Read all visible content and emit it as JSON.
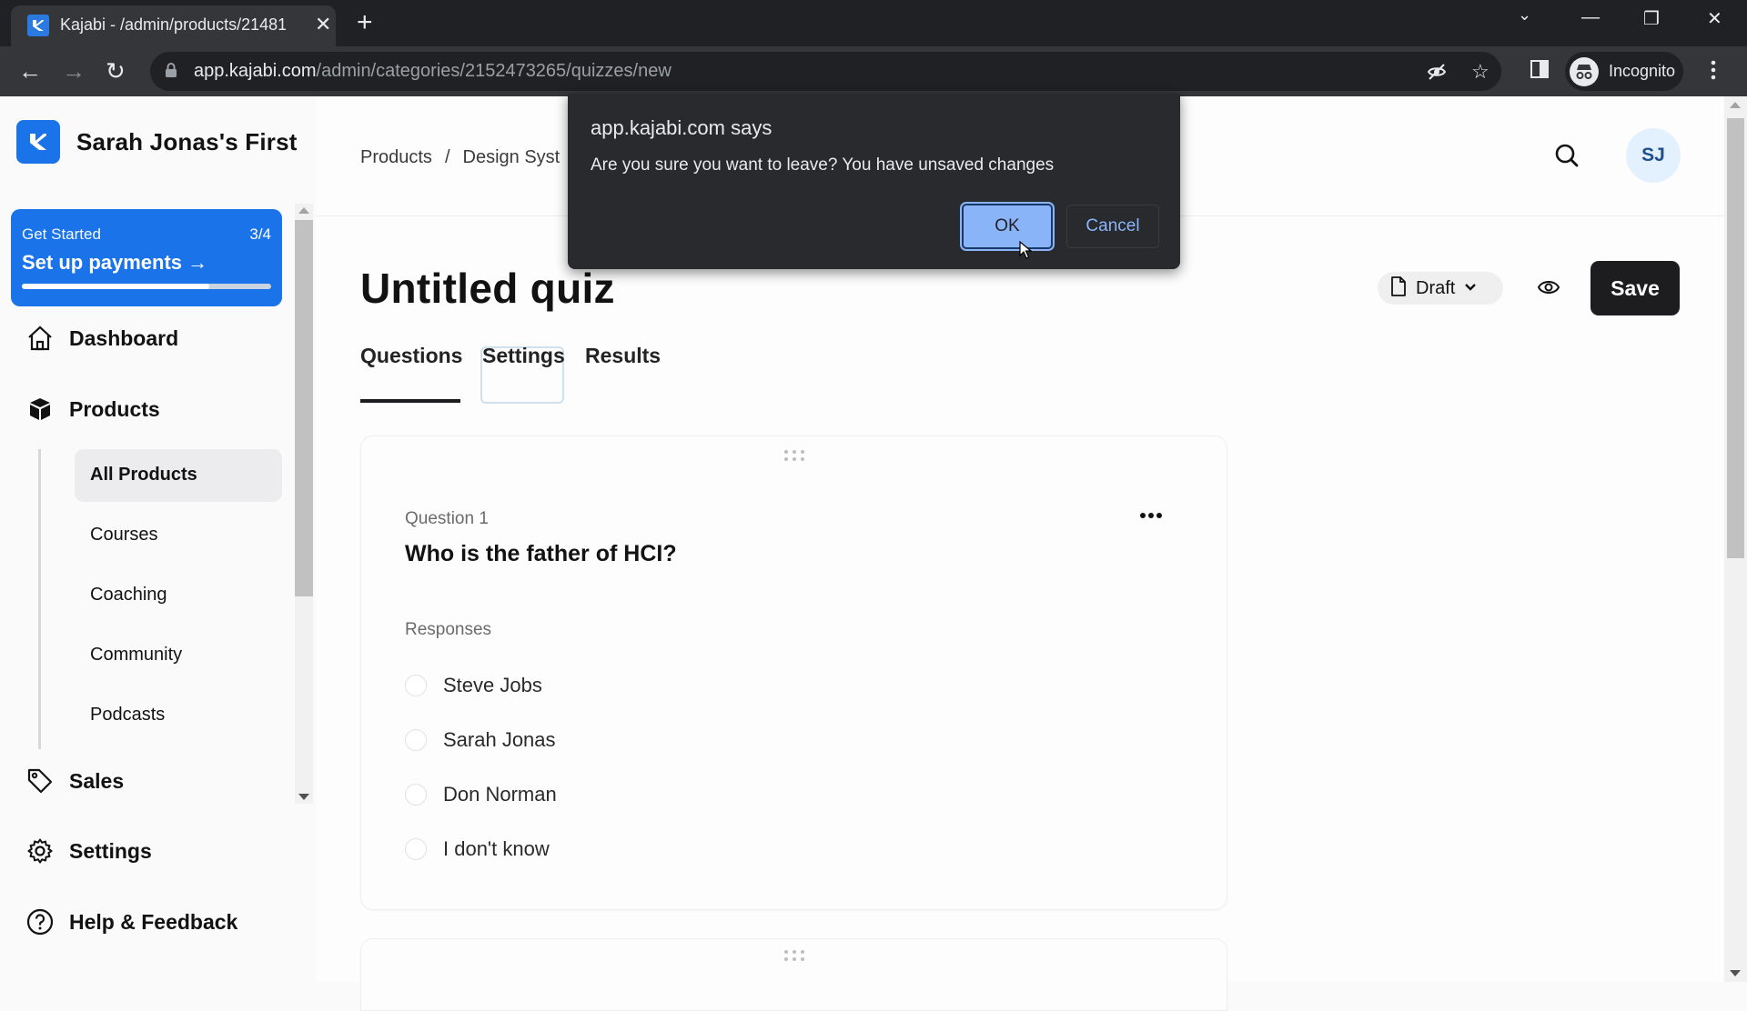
{
  "browser": {
    "tab_title": "Kajabi - /admin/products/21481",
    "url_host": "app.kajabi.com",
    "url_path": "/admin/categories/2152473265/quizzes/new",
    "profile_label": "Incognito"
  },
  "sidebar": {
    "site_name": "Sarah Jonas's First",
    "get_started": {
      "label": "Get Started",
      "count": "3/4",
      "action": "Set up payments",
      "progress": 0.75
    },
    "nav": [
      {
        "label": "Dashboard",
        "icon": "home-icon"
      },
      {
        "label": "Products",
        "icon": "box-icon"
      },
      {
        "label": "Sales",
        "icon": "tag-icon"
      },
      {
        "label": "Settings",
        "icon": "gear-icon"
      },
      {
        "label": "Help & Feedback",
        "icon": "help-icon"
      }
    ],
    "product_subitems": [
      "All Products",
      "Courses",
      "Coaching",
      "Community",
      "Podcasts"
    ],
    "active_subitem": "All Products"
  },
  "header": {
    "breadcrumb": [
      "Products",
      "Design Syst"
    ],
    "avatar_initials": "SJ"
  },
  "page": {
    "title": "Untitled quiz",
    "status": "Draft",
    "save_label": "Save",
    "tabs": [
      "Questions",
      "Settings",
      "Results"
    ],
    "active_tab": "Questions"
  },
  "question": {
    "label": "Question 1",
    "text": "Who is the father of HCI?",
    "responses_label": "Responses",
    "options": [
      "Steve Jobs",
      "Sarah Jonas",
      "Don Norman",
      "I don't know"
    ]
  },
  "dialog": {
    "title": "app.kajabi.com says",
    "message": "Are you sure you want to leave? You have unsaved changes",
    "ok_label": "OK",
    "cancel_label": "Cancel"
  }
}
